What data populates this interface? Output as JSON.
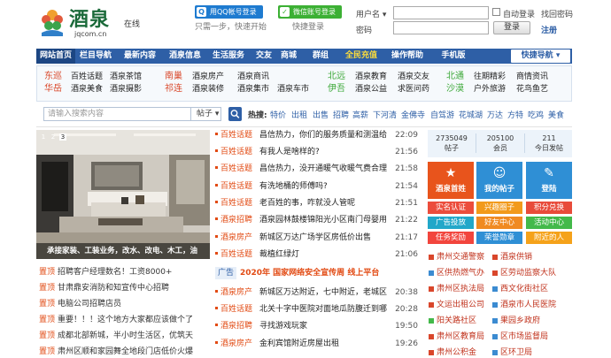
{
  "header": {
    "logo_text": "酒泉",
    "logo_online": "在线",
    "logo_domain": "jqcom.cn",
    "qq_login": "用QQ帐号登录",
    "wechat_login": "微信账号登录",
    "qq_note": "只需一步，快速开始",
    "wechat_note": "快捷登录",
    "user_label": "用户名",
    "password_label": "密码",
    "auto_login": "自动登录",
    "find_password": "找回密码",
    "login_button": "登录",
    "register": "注册"
  },
  "nav": {
    "items": [
      "网站首页",
      "栏目导航",
      "最新内容",
      "酒泉信息",
      "生活服务",
      "交友",
      "商城",
      "群组",
      "全民充值",
      "操作帮助",
      "手机版"
    ],
    "quick": "快捷导航"
  },
  "categories": {
    "groups": [
      {
        "regions": [
          "东巡",
          "华岳"
        ],
        "links": [
          "百姓话题",
          "酒泉茶馆",
          "酒泉美食",
          "酒泉摄影"
        ]
      },
      {
        "regions": [
          "南巢",
          "祁连"
        ],
        "links": [
          "酒泉房产",
          "酒泉商讯",
          "酒泉装修",
          "酒泉集市",
          "酒泉车市"
        ]
      },
      {
        "regions": [
          "北远",
          "伊吾"
        ],
        "links": [
          "酒泉教育",
          "酒泉交友",
          "酒泉公益",
          "求医问药"
        ]
      },
      {
        "regions": [
          "北通",
          "沙漠"
        ],
        "links": [
          "往期精彩",
          "商情资讯",
          "户外旅游",
          "花鸟鱼艺"
        ]
      }
    ]
  },
  "search": {
    "placeholder": "请输入搜索内容",
    "scope": "帖子",
    "hot_label": "热搜:",
    "hot": [
      "特价",
      "出租",
      "出售",
      "招聘",
      "高薪",
      "下河清",
      "金佛寺",
      "自驾游",
      "花城湖",
      "万达",
      "方特",
      "吃鸡",
      "美食"
    ]
  },
  "slideshow": {
    "caption": "承接家装、工装业务，改水、改电、木工，油",
    "dots": [
      "1",
      "2",
      "3"
    ]
  },
  "left_list": [
    {
      "tag": "置顶",
      "text": "招聘客户经理数名！工资8000+"
    },
    {
      "tag": "置顶",
      "text": "甘肃鼎安消防和知宣传中心招聘"
    },
    {
      "tag": "置顶",
      "text": "电脑公司招聘店员"
    },
    {
      "tag": "置顶",
      "text": "重要！！！这个地方大家都应该做个了"
    },
    {
      "tag": "置顶",
      "text": "成都北部新城，半小时生活区，优筑天"
    },
    {
      "tag": "置顶",
      "text": "肃州区顺和家园舞全地段门店低价火爆"
    }
  ],
  "center_list": [
    {
      "cat": "百姓话题",
      "title": "昌信热力，你们的服务质量和测温给",
      "time": "22:09"
    },
    {
      "cat": "百姓话题",
      "title": "有我人是啥样的?",
      "time": "21:56"
    },
    {
      "cat": "百姓话题",
      "title": "昌信热力，没开通暖气收暖气费合理",
      "time": "21:58"
    },
    {
      "cat": "百姓话题",
      "title": "有洗地桶的师傅吗?",
      "time": "21:54"
    },
    {
      "cat": "百姓话题",
      "title": "老百姓的事，咋就没人管呢",
      "time": "21:51"
    },
    {
      "cat": "酒泉招聘",
      "title": "酒泉园林鼓楼锦阳光小区南门母婴用",
      "time": "21:22"
    },
    {
      "cat": "酒泉房产",
      "title": "新城区万达广场学区房低价出售",
      "time": "21:17"
    },
    {
      "cat": "百姓话题",
      "title": "裁植红绿灯",
      "time": "21:06"
    }
  ],
  "ad": {
    "tag": "广告",
    "text": "2020年 国家网络安全宣传周 线上平台"
  },
  "center_list2": [
    {
      "cat": "酒泉房产",
      "title": "新城区万达附近，七中附近，老城区",
      "time": "20:38"
    },
    {
      "cat": "百姓话题",
      "title": "北关十字中医院对面地瓜防腹迁到哪",
      "time": "20:28"
    },
    {
      "cat": "酒泉招聘",
      "title": "寻找游戏玩家",
      "time": "19:50"
    },
    {
      "cat": "酒泉房产",
      "title": "金利宾馆附近房屋出租",
      "time": "19:26"
    }
  ],
  "stats": [
    {
      "value": "2735049",
      "label": "帖子"
    },
    {
      "value": "205100",
      "label": "会员"
    },
    {
      "value": "211",
      "label": "今日发帖"
    }
  ],
  "tiles": [
    {
      "label": "酒泉首姓",
      "glyph": "★",
      "color": "#e8541c"
    },
    {
      "label": "我的帖子",
      "glyph": "☺",
      "color": "#2f8fd5"
    },
    {
      "label": "登陆",
      "glyph": "✎",
      "color": "#2f8fd5"
    }
  ],
  "buttons": [
    {
      "label": "实名认证",
      "color": "#ec4d3c"
    },
    {
      "label": "兴趣圈子",
      "color": "#f29a1b"
    },
    {
      "label": "积分兑换",
      "color": "#e84b3a"
    },
    {
      "label": "广告投放",
      "color": "#22a7c9"
    },
    {
      "label": "好友中心",
      "color": "#f08a21"
    },
    {
      "label": "活动中心",
      "color": "#43b94a"
    },
    {
      "label": "任务奖励",
      "color": "#f2453d"
    },
    {
      "label": "荣誉勋章",
      "color": "#2f8fd5"
    },
    {
      "label": "附近的人",
      "color": "#f5a21a"
    }
  ],
  "right_list": [
    {
      "text": "肃州交通警察",
      "color": "#d9462b"
    },
    {
      "text": "酒泉供销",
      "color": "#d9462b"
    },
    {
      "text": "区供热燃气办",
      "color": "#3b8bd1"
    },
    {
      "text": "区劳动监察大队",
      "color": "#d9462b"
    },
    {
      "text": "肃州区执法局",
      "color": "#d9462b"
    },
    {
      "text": "西文化街社区",
      "color": "#3b8bd1"
    },
    {
      "text": "文运出租公司",
      "color": "#d9462b"
    },
    {
      "text": "酒泉市人民医院",
      "color": "#3b8bd1"
    },
    {
      "text": "阳关路社区",
      "color": "#43b94a"
    },
    {
      "text": "果园乡政府",
      "color": "#3b8bd1"
    },
    {
      "text": "肃州区教育局",
      "color": "#d9462b"
    },
    {
      "text": "区市场监督局",
      "color": "#3b8bd1"
    },
    {
      "text": "肃州公积金",
      "color": "#d9462b"
    },
    {
      "text": "区环卫局",
      "color": "#3b8bd1"
    }
  ],
  "colors": {
    "nav_blue": "#2e5fa6",
    "accent_red": "#e24b14",
    "region_red": "#d9482a",
    "region_green": "#3ea93a"
  }
}
